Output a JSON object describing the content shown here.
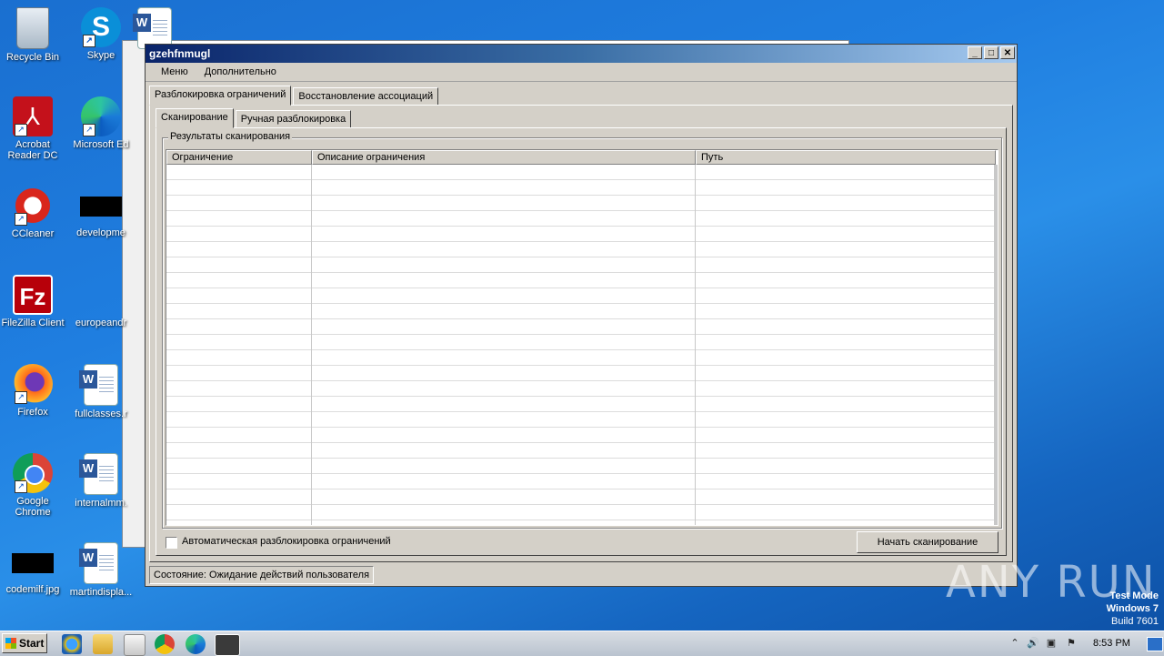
{
  "desktop": {
    "icons": [
      {
        "label": "Recycle Bin",
        "icon": "recycle-bin-icon"
      },
      {
        "label": "Skype",
        "icon": "skype-icon"
      },
      {
        "label": "Acrobat Reader DC",
        "icon": "acrobat-icon"
      },
      {
        "label": "Microsoft Ed",
        "icon": "edge-icon"
      },
      {
        "label": "CCleaner",
        "icon": "ccleaner-icon"
      },
      {
        "label": "developme",
        "icon": "file-icon"
      },
      {
        "label": "FileZilla Client",
        "icon": "filezilla-icon"
      },
      {
        "label": "europeandr",
        "icon": "file-icon"
      },
      {
        "label": "Firefox",
        "icon": "firefox-icon"
      },
      {
        "label": "fullclasses.r",
        "icon": "word-doc-icon"
      },
      {
        "label": "Google Chrome",
        "icon": "chrome-icon"
      },
      {
        "label": "internalmm.",
        "icon": "word-doc-icon"
      },
      {
        "label": "codemilf.jpg",
        "icon": "image-file-icon"
      },
      {
        "label": "martindispla...",
        "icon": "word-doc-icon"
      }
    ]
  },
  "window": {
    "title": "gzehfnmugl",
    "controls": {
      "minimize": "_",
      "maximize": "□",
      "close": "✕"
    },
    "menu": [
      "Меню",
      "Дополнительно"
    ],
    "tabs": [
      "Разблокировка ограничений",
      "Восстановление ассоциаций"
    ],
    "subtabs": [
      "Сканирование",
      "Ручная разблокировка"
    ],
    "group_title": "Результаты сканирования",
    "columns": [
      "Ограничение",
      "Описание ограничения",
      "Путь"
    ],
    "checkbox_label": "Автоматическая разблокировка ограничений",
    "scan_button": "Начать сканирование",
    "status": "Состояние: Ожидание действий пользователя"
  },
  "watermark": "ANY RUN",
  "test_mode": {
    "line1": "Test Mode",
    "line2": "Windows 7",
    "line3": "Build 7601"
  },
  "taskbar": {
    "start_label": "Start",
    "clock": "8:53 PM"
  }
}
